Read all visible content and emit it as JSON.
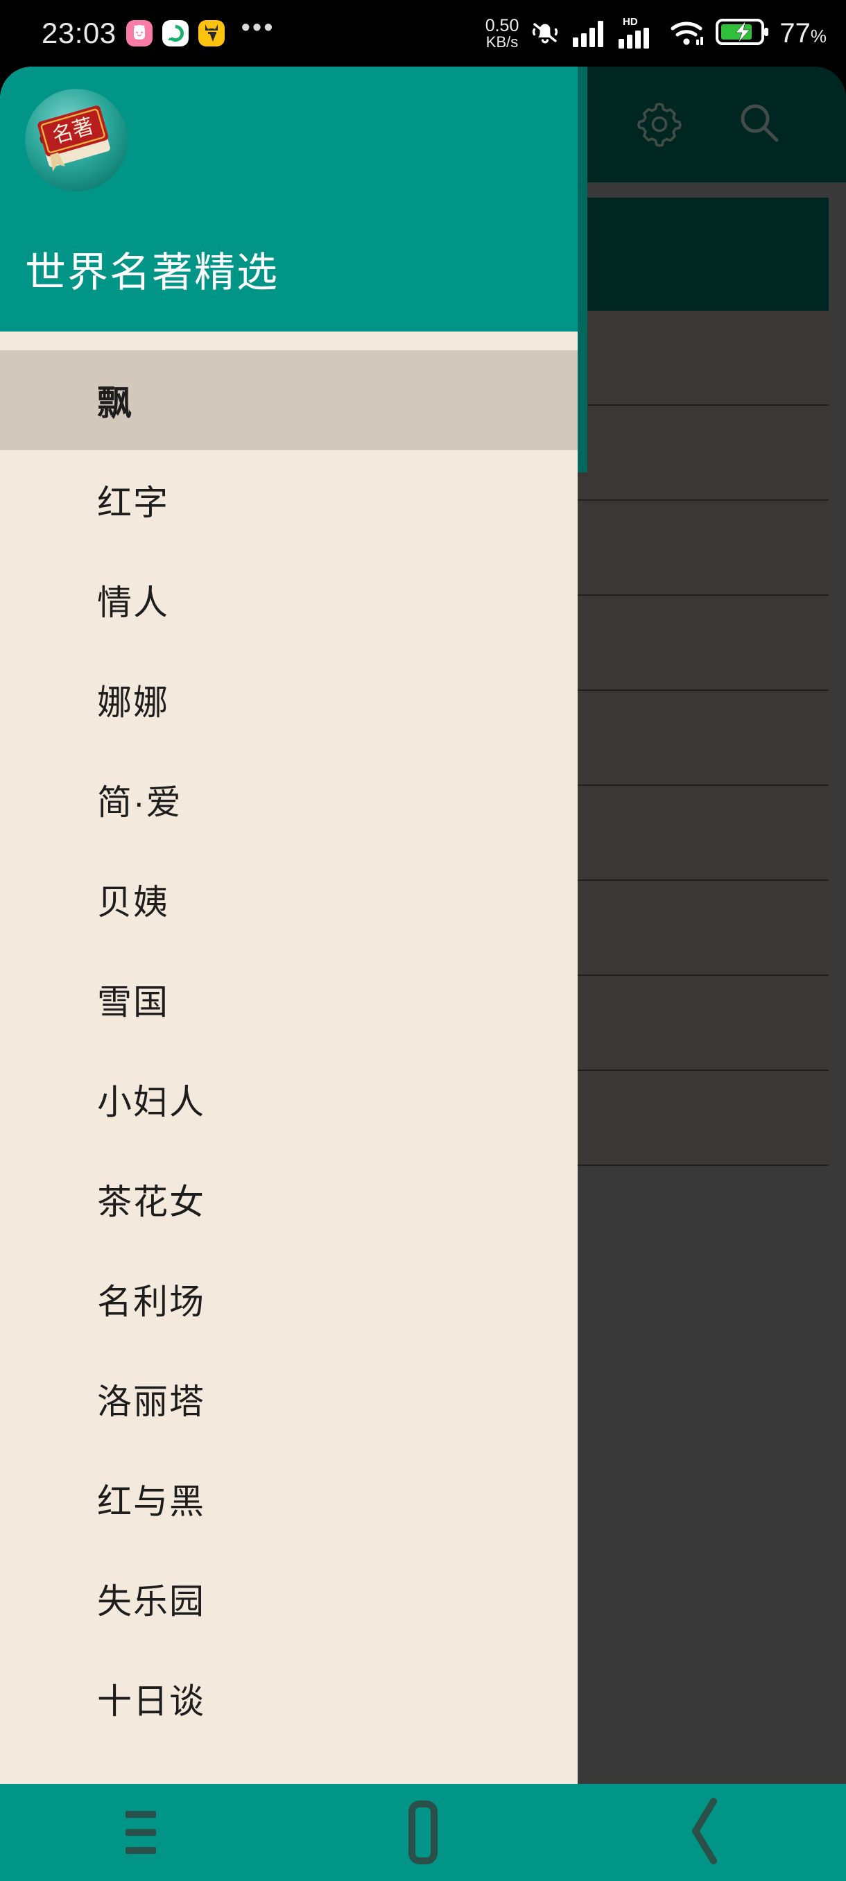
{
  "status_bar": {
    "time": "23:03",
    "notification_icons": [
      "rabbit-app-icon",
      "green-camera-app-icon",
      "yellow-cat-app-icon"
    ],
    "overflow_label": "•••",
    "net_speed_value": "0.50",
    "net_speed_unit": "KB/s",
    "right_icons": [
      "silent-bell-icon",
      "signal-bars-icon",
      "hd-signal-bars-icon",
      "wifi-icon",
      "battery-charging-icon"
    ],
    "hd_label": "HD",
    "battery_percent": "77",
    "battery_percent_symbol": "%",
    "background_color": "#000000",
    "text_color": "#ededed"
  },
  "app_bar": {
    "settings_icon": "gear-icon",
    "search_icon": "search-icon",
    "background_color": "#004038",
    "icon_color": "#6f7f7b"
  },
  "drawer": {
    "open": true,
    "header": {
      "avatar_icon": "book-app-logo",
      "avatar_label": "名著",
      "title": "世界名著精选",
      "background_color": "#009587",
      "title_color": "#ffffff"
    },
    "list_background_color": "#f3e9dd",
    "selected_background_color": "#d3c8bc",
    "selected_index": 0,
    "items": [
      {
        "label": "飘",
        "selected": true
      },
      {
        "label": "红字",
        "selected": false
      },
      {
        "label": "情人",
        "selected": false
      },
      {
        "label": "娜娜",
        "selected": false
      },
      {
        "label": "简·爱",
        "selected": false
      },
      {
        "label": "贝姨",
        "selected": false
      },
      {
        "label": "雪国",
        "selected": false
      },
      {
        "label": "小妇人",
        "selected": false
      },
      {
        "label": "茶花女",
        "selected": false
      },
      {
        "label": "名利场",
        "selected": false
      },
      {
        "label": "洛丽塔",
        "selected": false
      },
      {
        "label": "红与黑",
        "selected": false
      },
      {
        "label": "失乐园",
        "selected": false
      },
      {
        "label": "十日谈",
        "selected": false
      }
    ]
  },
  "content": {
    "scrim_color": "rgba(0,0,0,0.40)",
    "background_color": "#5f5f5f",
    "card_color": "#004038",
    "row_color": "#615d58",
    "row_count": 9
  },
  "nav_bar": {
    "background_color": "#009587",
    "icon_color": "#2b5049",
    "buttons": [
      {
        "name": "recents-button",
        "icon": "hamburger-icon"
      },
      {
        "name": "home-button",
        "icon": "square-icon"
      },
      {
        "name": "back-button",
        "icon": "chevron-left-icon"
      }
    ]
  }
}
